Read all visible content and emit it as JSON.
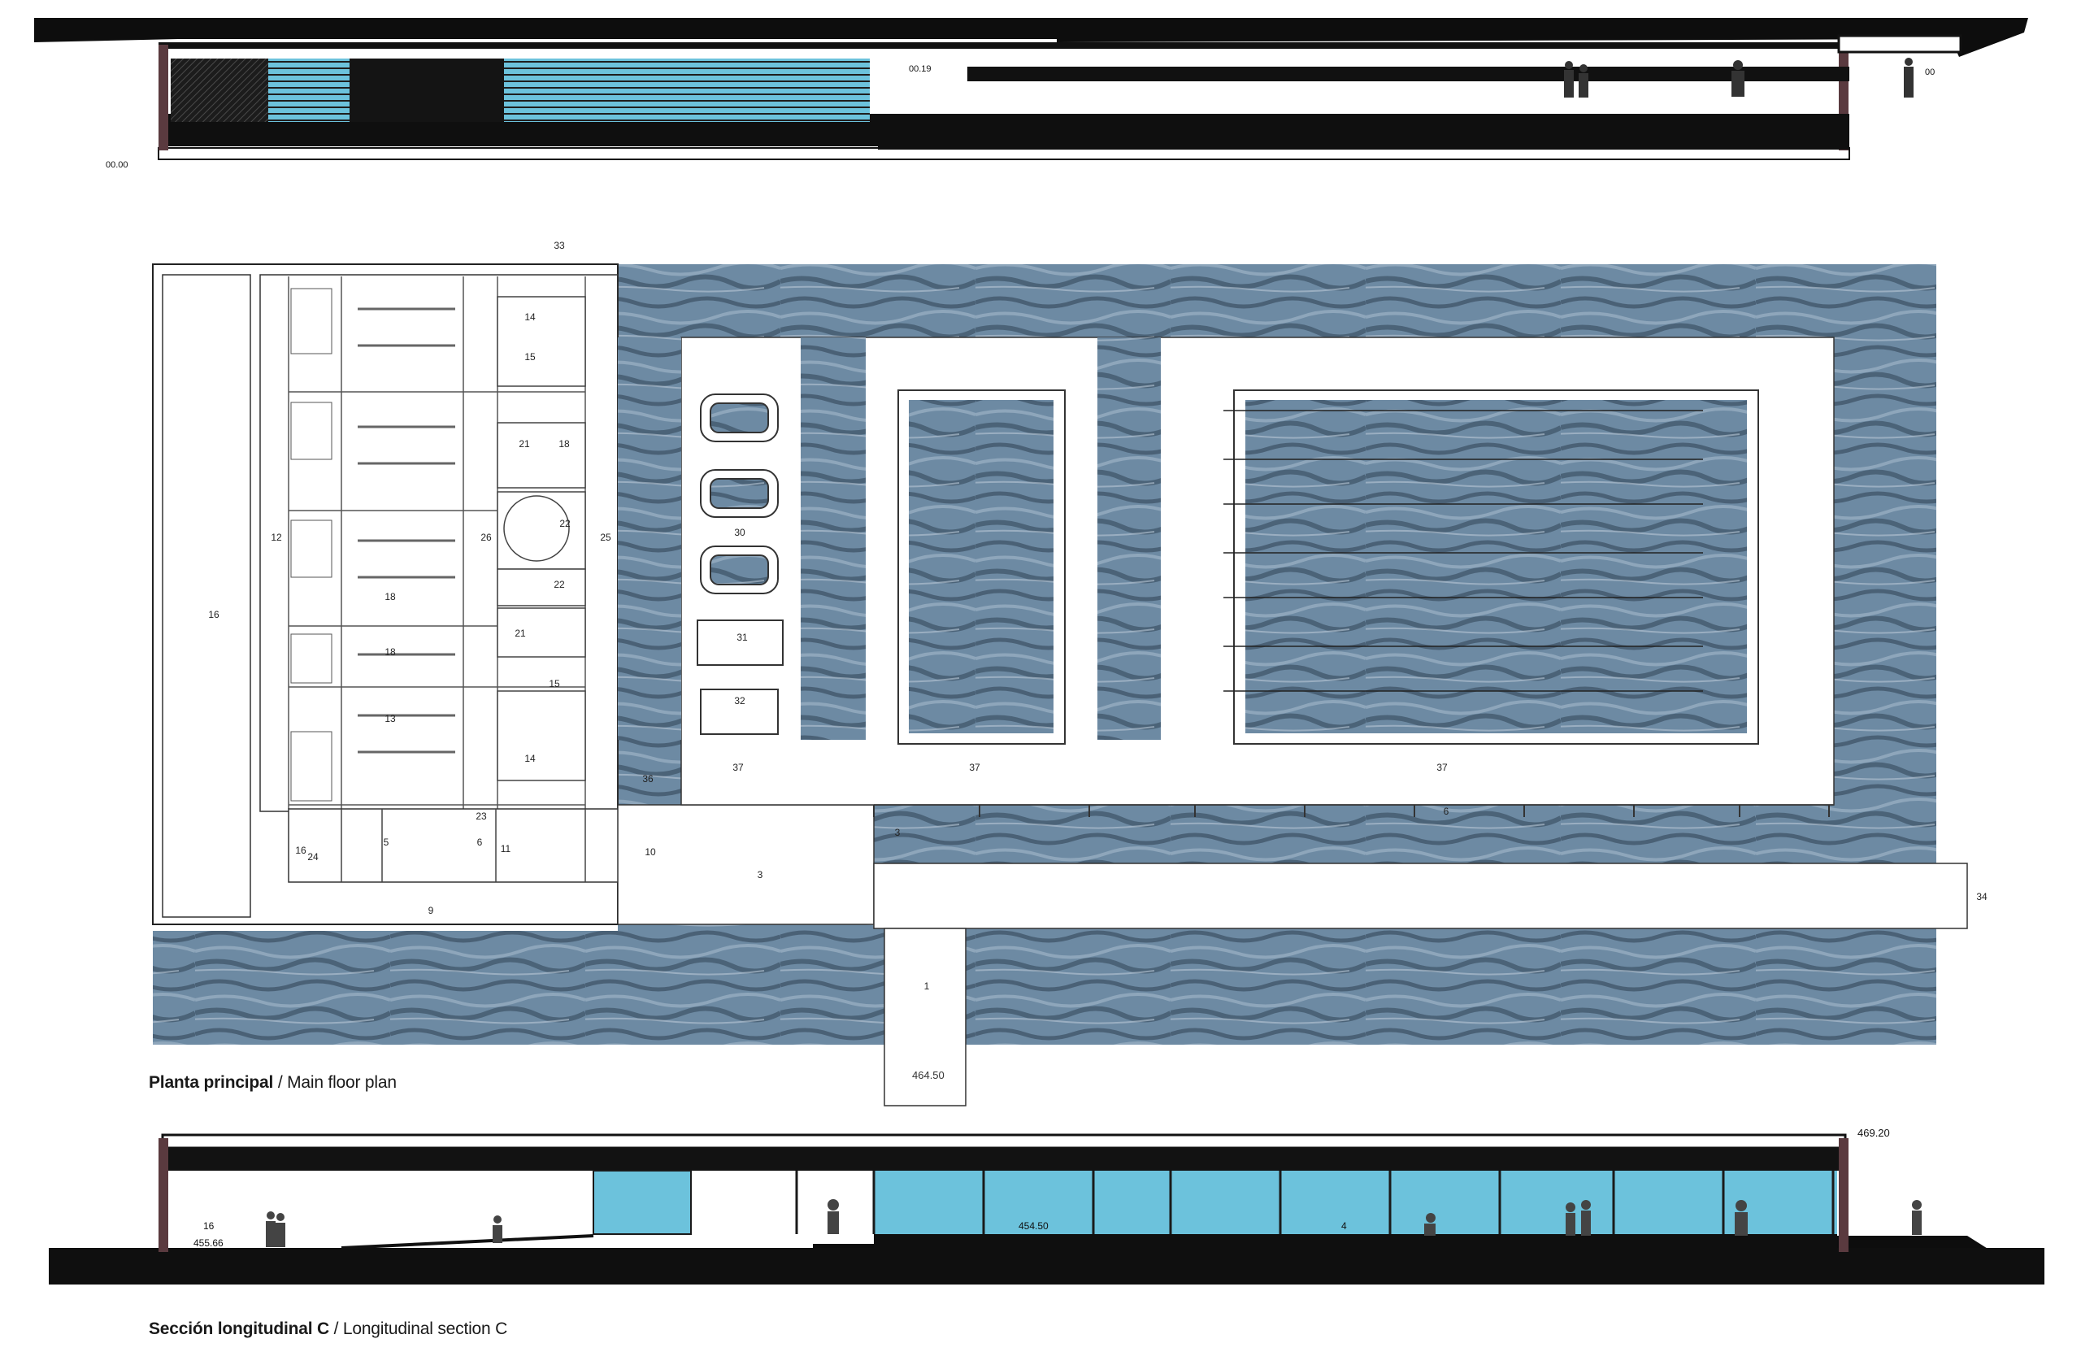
{
  "drawing": {
    "plan_caption": {
      "primary": "Planta principal",
      "separator": " / ",
      "secondary": "Main floor plan"
    },
    "section_caption": {
      "primary": "Sección longitudinal C",
      "separator": " / ",
      "secondary": "Longitudinal section C"
    }
  },
  "top_section": {
    "levels": [
      "00.00",
      "00.19",
      "00"
    ]
  },
  "bottom_section": {
    "levels": [
      "469.20",
      "455.66",
      "454.50"
    ],
    "room_labels": [
      "16",
      "4"
    ]
  },
  "plan": {
    "entry_level": "464.50",
    "room_labels": [
      {
        "text": "33"
      },
      {
        "text": "14"
      },
      {
        "text": "15"
      },
      {
        "text": "21"
      },
      {
        "text": "18"
      },
      {
        "text": "22"
      },
      {
        "text": "26"
      },
      {
        "text": "22"
      },
      {
        "text": "21"
      },
      {
        "text": "18"
      },
      {
        "text": "15"
      },
      {
        "text": "14"
      },
      {
        "text": "13"
      },
      {
        "text": "16"
      },
      {
        "text": "18"
      },
      {
        "text": "16"
      },
      {
        "text": "12"
      },
      {
        "text": "30"
      },
      {
        "text": "31"
      },
      {
        "text": "32"
      },
      {
        "text": "37"
      },
      {
        "text": "37"
      },
      {
        "text": "37"
      },
      {
        "text": "36"
      },
      {
        "text": "6"
      },
      {
        "text": "5"
      },
      {
        "text": "11"
      },
      {
        "text": "10"
      },
      {
        "text": "3"
      },
      {
        "text": "9"
      },
      {
        "text": "1"
      },
      {
        "text": "34"
      },
      {
        "text": "24"
      },
      {
        "text": "23"
      },
      {
        "text": "25"
      },
      {
        "text": "6"
      },
      {
        "text": "3"
      }
    ]
  },
  "colors": {
    "water": "#5e7890",
    "glass": "#6cc2dc",
    "ink": "#111111",
    "paper": "#ffffff"
  }
}
